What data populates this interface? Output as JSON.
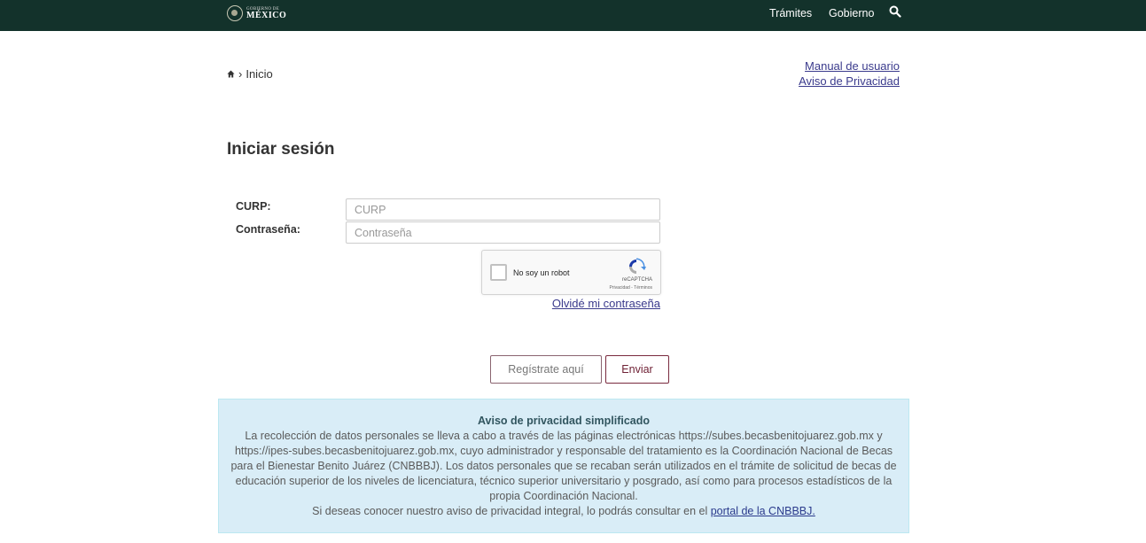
{
  "header": {
    "logo": {
      "line1": "GOBIERNO DE",
      "line2": "MÉXICO"
    },
    "nav": [
      {
        "label": "Trámites"
      },
      {
        "label": "Gobierno"
      }
    ],
    "search_icon": "search-icon",
    "background_color": "#13322b"
  },
  "breadcrumb": {
    "home_icon": "home-icon",
    "separator": "›",
    "label": "Inicio"
  },
  "top_links": {
    "manual": "Manual de usuario",
    "privacy": "Aviso de Privacidad"
  },
  "page_title": "Iniciar sesión",
  "form": {
    "curp": {
      "label": "CURP:",
      "value": "",
      "placeholder": "CURP"
    },
    "password": {
      "label": "Contraseña:",
      "value": "",
      "placeholder": "Contraseña"
    },
    "recaptcha": {
      "checkbox_label": "No soy un robot",
      "brand": "reCAPTCHA",
      "terms": "Privacidad - Términos"
    },
    "forgot_password": "Olvidé mi contraseña"
  },
  "buttons": {
    "register": "Regístrate aquí",
    "submit": "Enviar"
  },
  "privacy_notice": {
    "title": "Aviso de privacidad simplificado",
    "body": "La recolección de datos personales se lleva a cabo a través de las páginas electrónicas https://subes.becasbenitojuarez.gob.mx y https://ipes-subes.becasbenitojuarez.gob.mx, cuyo administrador y responsable del tratamiento es la Coordinación Nacional de Becas para el Bienestar Benito Juárez (CNBBBJ). Los datos personales que se recaban serán utilizados en el trámite de solicitud de becas de educación superior de los niveles de licenciatura, técnico superior universitario y posgrado, así como para procesos estadísticos de la propia Coordinación Nacional.",
    "more_text": "Si deseas conocer nuestro aviso de privacidad integral, lo podrás consultar en el",
    "more_link": "portal de la CNBBBJ."
  },
  "colors": {
    "accent": "#9d2449",
    "link": "#3a3a8c",
    "notice_bg": "#d9edf7"
  }
}
